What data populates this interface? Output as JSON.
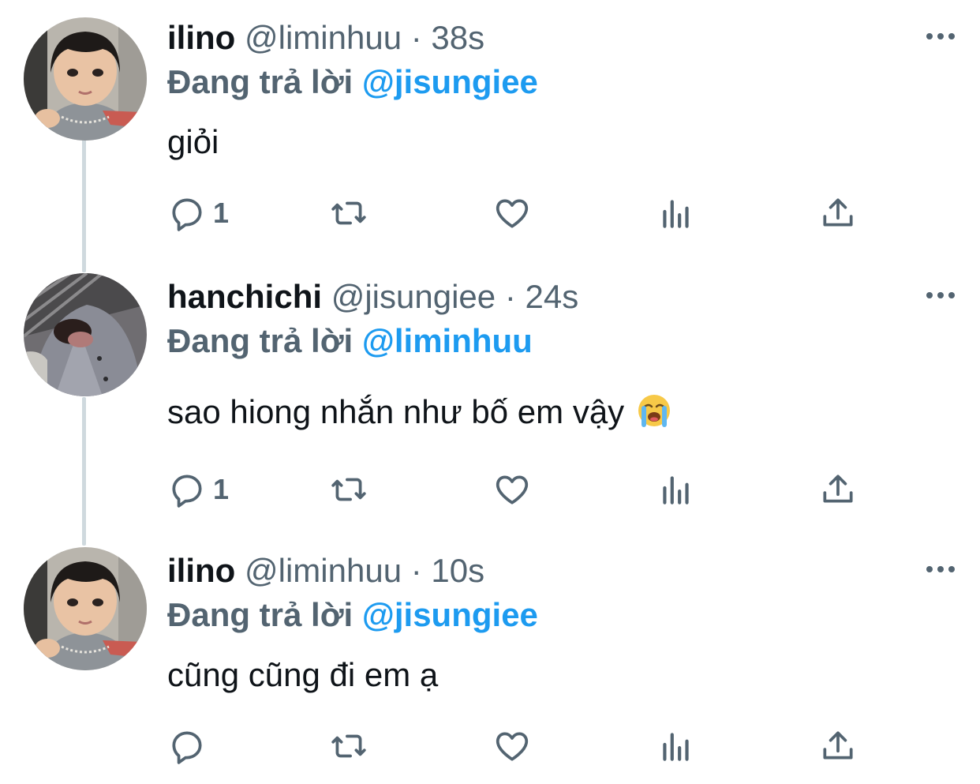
{
  "tweets": [
    {
      "name": "ilino",
      "handle": "@liminhuu",
      "time": "38s",
      "reply_prefix": "Đang trả lời",
      "reply_to": "@jisungiee",
      "text": "giỏi",
      "reply_count": "1",
      "avatar": "boy-avatar"
    },
    {
      "name": "hanchichi",
      "handle": "@jisungiee",
      "time": "24s",
      "reply_prefix": "Đang trả lời",
      "reply_to": "@liminhuu",
      "text": "sao hiong nhắn như bố em vậy",
      "emoji": "loudly-crying-face",
      "reply_count": "1",
      "avatar": "cat-avatar"
    },
    {
      "name": "ilino",
      "handle": "@liminhuu",
      "time": "10s",
      "reply_prefix": "Đang trả lời",
      "reply_to": "@jisungiee",
      "text": "cũng cũng đi em ạ",
      "reply_count": "",
      "avatar": "boy-avatar"
    }
  ],
  "separator": "·",
  "icons": [
    "reply-icon",
    "retweet-icon",
    "like-icon",
    "views-icon",
    "share-icon",
    "more-icon"
  ],
  "colors": {
    "text": "#0f1419",
    "secondary": "#536471",
    "mention": "#1d9bf0",
    "thread_line": "#cfd9de"
  }
}
